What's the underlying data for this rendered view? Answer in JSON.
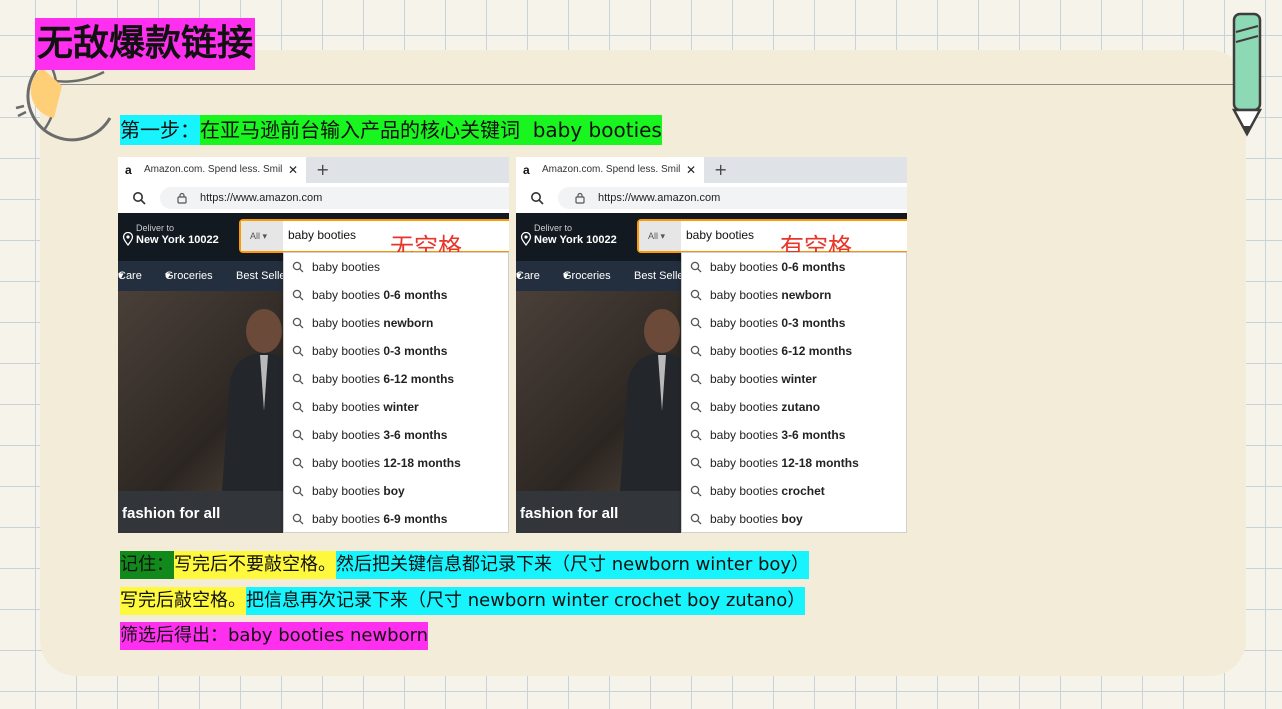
{
  "slide": {
    "title": "无敌爆款链接",
    "step_label": "第一步：",
    "step_text": "在亚马逊前台输入产品的核心关键词  baby booties"
  },
  "screenshots": [
    {
      "tab_title": "Amazon.com. Spend less. Smile more.",
      "url": "https://www.amazon.com",
      "deliver_line1": "Deliver to",
      "deliver_line2": "New York 10022",
      "search_category": "All",
      "query": "baby booties",
      "annotation": "无空格",
      "subnav": [
        "Care",
        "Groceries",
        "Best Sellers"
      ],
      "hero_text": "fashion for all",
      "suggestions": [
        {
          "base": "baby booties",
          "bold": ""
        },
        {
          "base": "baby booties ",
          "bold": "0-6 months"
        },
        {
          "base": "baby booties ",
          "bold": "newborn"
        },
        {
          "base": "baby booties ",
          "bold": "0-3 months"
        },
        {
          "base": "baby booties ",
          "bold": "6-12 months"
        },
        {
          "base": "baby booties ",
          "bold": "winter"
        },
        {
          "base": "baby booties ",
          "bold": "3-6 months"
        },
        {
          "base": "baby booties ",
          "bold": "12-18 months"
        },
        {
          "base": "baby booties ",
          "bold": "boy"
        },
        {
          "base": "baby booties ",
          "bold": "6-9 months"
        }
      ]
    },
    {
      "tab_title": "Amazon.com. Spend less. Smile more.",
      "url": "https://www.amazon.com",
      "deliver_line1": "Deliver to",
      "deliver_line2": "New York 10022",
      "search_category": "All",
      "query": "baby booties ",
      "annotation": "有空格",
      "subnav": [
        "Care",
        "Groceries",
        "Best Sellers"
      ],
      "hero_text": "fashion for all",
      "suggestions": [
        {
          "base": "baby booties ",
          "bold": "0-6 months"
        },
        {
          "base": "baby booties ",
          "bold": "newborn"
        },
        {
          "base": "baby booties ",
          "bold": "0-3 months"
        },
        {
          "base": "baby booties ",
          "bold": "6-12 months"
        },
        {
          "base": "baby booties ",
          "bold": "winter"
        },
        {
          "base": "baby booties ",
          "bold": "zutano"
        },
        {
          "base": "baby booties ",
          "bold": "3-6 months"
        },
        {
          "base": "baby booties ",
          "bold": "12-18 months"
        },
        {
          "base": "baby booties ",
          "bold": "crochet"
        },
        {
          "base": "baby booties ",
          "bold": "boy"
        }
      ]
    }
  ],
  "notes": {
    "remember_label": "记住：",
    "remember_text": "写完后不要敲空格。",
    "remember_tail": "然后把关键信息都记录下来（尺寸 newborn winter boy）",
    "space_text": "写完后敲空格。",
    "space_tail": "把信息再次记录下来（尺寸 newborn winter crochet boy zutano）",
    "result": "筛选后得出：baby booties newborn"
  },
  "colors": {
    "highlight_pink": "#ff2ff0",
    "highlight_cyan": "#17f4fd",
    "highlight_green": "#19f51e",
    "highlight_yellow": "#fff93e",
    "highlight_dark_green": "#118a1b",
    "amazon_nav": "#131921",
    "amazon_orange": "#ff9900",
    "annotation_red": "#e8352a"
  }
}
